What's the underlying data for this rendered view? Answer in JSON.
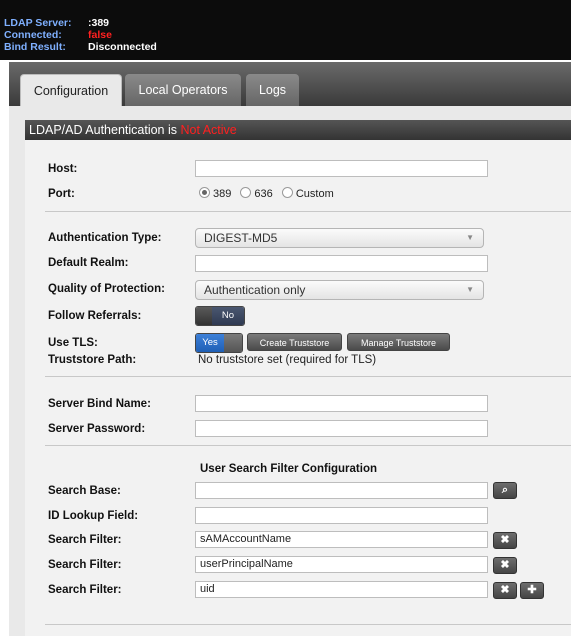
{
  "status": {
    "server_label": "LDAP Server:",
    "server_value": ":389",
    "connected_label": "Connected:",
    "connected_value": "false",
    "bind_label": "Bind Result:",
    "bind_value": "Disconnected"
  },
  "tabs": [
    {
      "label": "Configuration",
      "active": true
    },
    {
      "label": "Local Operators",
      "active": false
    },
    {
      "label": "Logs",
      "active": false
    }
  ],
  "header": {
    "prefix": "LDAP/AD Authentication is ",
    "status": "Not Active"
  },
  "form": {
    "host_label": "Host:",
    "host_value": "",
    "port_label": "Port:",
    "port_options": [
      "389",
      "636",
      "Custom"
    ],
    "port_selected": "389",
    "auth_type_label": "Authentication Type:",
    "auth_type_value": "DIGEST-MD5",
    "realm_label": "Default Realm:",
    "realm_value": "",
    "qop_label": "Quality of Protection:",
    "qop_value": "Authentication only",
    "follow_label": "Follow Referrals:",
    "follow_value": "No",
    "tls_label": "Use TLS:",
    "tls_value": "Yes",
    "create_truststore": "Create Truststore",
    "manage_truststore": "Manage Truststore",
    "truststore_label": "Truststore Path:",
    "truststore_value": "No truststore set (required for TLS)",
    "bind_name_label": "Server Bind Name:",
    "bind_name_value": "",
    "password_label": "Server Password:",
    "password_value": "",
    "search_section_title": "User Search Filter Configuration",
    "search_base_label": "Search Base:",
    "search_base_value": "",
    "id_lookup_label": "ID Lookup Field:",
    "id_lookup_value": "",
    "filter_label": "Search Filter:",
    "filters": [
      "sAMAccountName",
      "userPrincipalName",
      "uid"
    ]
  },
  "icons": {
    "search": "search-icon",
    "remove": "remove-icon",
    "add": "add-icon",
    "dropdown": "chevron-down-icon"
  },
  "colors": {
    "status_label": "#7fb0ff",
    "alert_red": "#ff2020",
    "toggle_yes": "#2f6fc6"
  }
}
